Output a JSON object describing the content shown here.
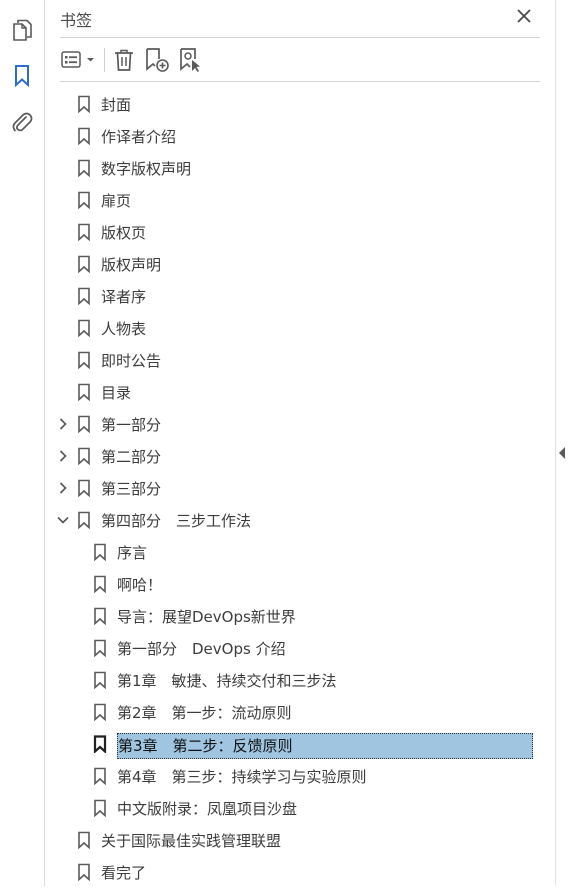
{
  "panel": {
    "title": "书签"
  },
  "rail": {
    "items": [
      {
        "icon": "pages-icon"
      },
      {
        "icon": "bookmark-icon",
        "active": true
      },
      {
        "icon": "attachment-icon"
      }
    ]
  },
  "toolbar": {
    "buttons": [
      "options-menu-icon",
      "delete-icon",
      "new-bookmark-icon",
      "new-bookmark-from-structure-icon"
    ]
  },
  "bookmarks": [
    {
      "label": "封面",
      "level": 0
    },
    {
      "label": "作译者介绍",
      "level": 0
    },
    {
      "label": "数字版权声明",
      "level": 0
    },
    {
      "label": "扉页",
      "level": 0
    },
    {
      "label": "版权页",
      "level": 0
    },
    {
      "label": "版权声明",
      "level": 0
    },
    {
      "label": "译者序",
      "level": 0
    },
    {
      "label": "人物表",
      "level": 0
    },
    {
      "label": "即时公告",
      "level": 0
    },
    {
      "label": "目录",
      "level": 0
    },
    {
      "label": "第一部分",
      "level": 0,
      "toggle": "collapsed"
    },
    {
      "label": "第二部分",
      "level": 0,
      "toggle": "collapsed"
    },
    {
      "label": "第三部分",
      "level": 0,
      "toggle": "collapsed"
    },
    {
      "label": "第四部分　三步工作法",
      "level": 0,
      "toggle": "expanded"
    },
    {
      "label": "序言",
      "level": 1
    },
    {
      "label": "啊哈！",
      "level": 1
    },
    {
      "label": "导言：展望DevOps新世界",
      "level": 1
    },
    {
      "label": "第一部分　DevOps 介绍",
      "level": 1
    },
    {
      "label": "第1章　敏捷、持续交付和三步法",
      "level": 1
    },
    {
      "label": "第2章　第一步：流动原则",
      "level": 1
    },
    {
      "label": "第3章　第二步：反馈原则",
      "level": 1,
      "selected": true
    },
    {
      "label": "第4章　第三步：持续学习与实验原则",
      "level": 1
    },
    {
      "label": "中文版附录：凤凰项目沙盘",
      "level": 1
    },
    {
      "label": "关于国际最佳实践管理联盟",
      "level": 0
    },
    {
      "label": "看完了",
      "level": 0
    }
  ],
  "colors": {
    "accent": "#2b6ec9",
    "selection": "#9fc5e1",
    "icon": "#5a5a5a"
  }
}
